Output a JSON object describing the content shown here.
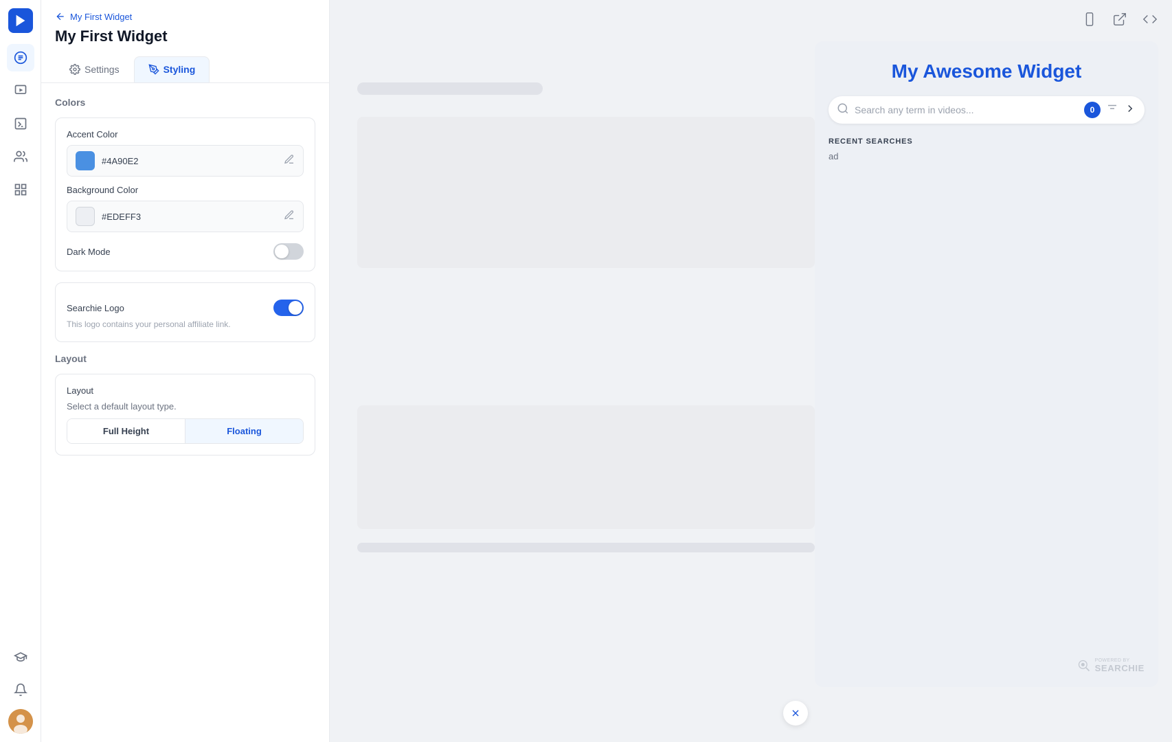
{
  "app": {
    "logo_aria": "Searchie logo"
  },
  "nav": {
    "items": [
      {
        "id": "list-icon",
        "label": "List view",
        "active": true
      },
      {
        "id": "play-icon",
        "label": "Play"
      },
      {
        "id": "terminal-icon",
        "label": "Terminal"
      },
      {
        "id": "users-icon",
        "label": "Users"
      },
      {
        "id": "grid-icon",
        "label": "Grid"
      },
      {
        "id": "graduation-icon",
        "label": "Courses"
      },
      {
        "id": "bell-icon",
        "label": "Notifications"
      }
    ]
  },
  "panel": {
    "breadcrumb": "My First Widget",
    "title": "My First Widget",
    "tabs": [
      {
        "id": "settings",
        "label": "Settings",
        "active": false
      },
      {
        "id": "styling",
        "label": "Styling",
        "active": true
      }
    ]
  },
  "colors": {
    "section_title": "Colors",
    "accent": {
      "label": "Accent Color",
      "hex": "#4A90E2",
      "swatch": "#4A90E2"
    },
    "background": {
      "label": "Background Color",
      "hex": "#EDEFF3",
      "swatch": "#EDEFF3"
    },
    "dark_mode": {
      "label": "Dark Mode",
      "enabled": false
    }
  },
  "searchie_logo": {
    "label": "Searchie Logo",
    "description": "This logo contains your personal affiliate link.",
    "enabled": true
  },
  "layout": {
    "section_title": "Layout",
    "card_title": "Layout",
    "card_description": "Select a default layout type.",
    "buttons": [
      {
        "id": "full-height",
        "label": "Full Height",
        "active": false
      },
      {
        "id": "floating",
        "label": "Floating",
        "active": true
      }
    ]
  },
  "widget_preview": {
    "title": "My Awesome Widget",
    "search_placeholder": "Search any term in videos...",
    "search_count": "0",
    "recent_title": "RECENT SEARCHES",
    "recent_item": "ad",
    "powered_by": "POWERED BY",
    "brand_name": "SEARCHIE"
  },
  "toolbar": {
    "icons": [
      "mobile-icon",
      "external-link-icon",
      "layout-icon"
    ]
  }
}
